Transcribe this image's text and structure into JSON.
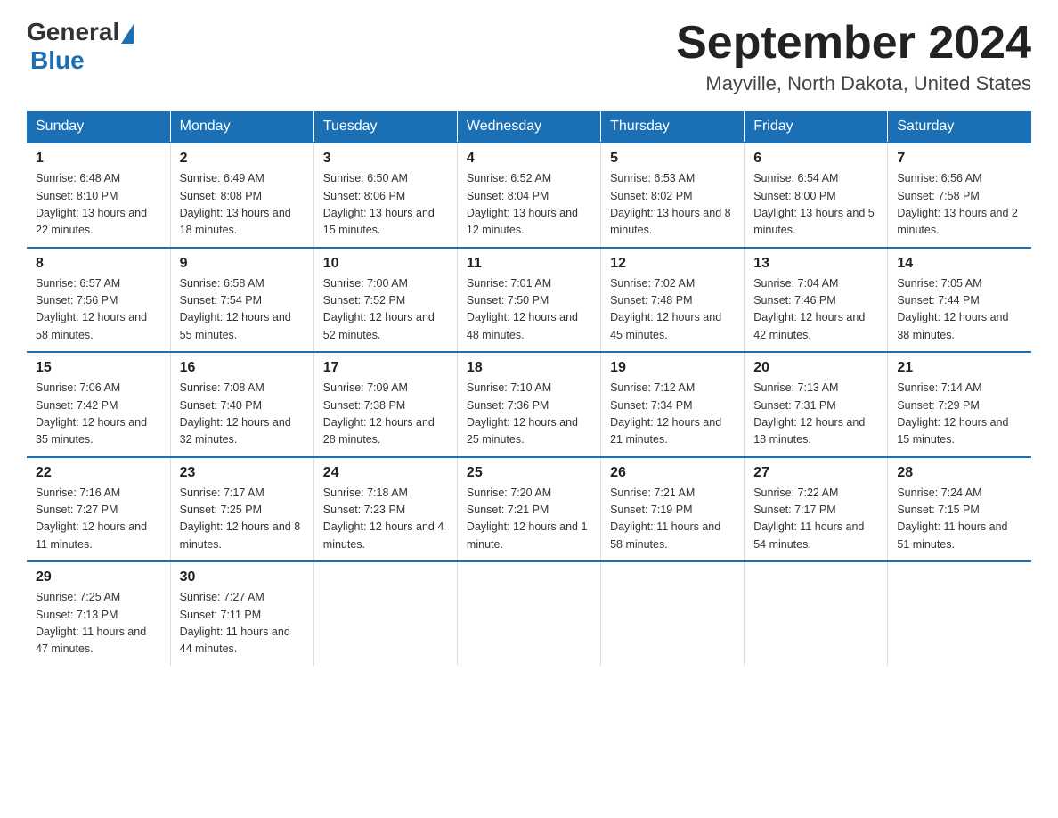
{
  "logo": {
    "general": "General",
    "blue": "Blue"
  },
  "title": "September 2024",
  "location": "Mayville, North Dakota, United States",
  "days_of_week": [
    "Sunday",
    "Monday",
    "Tuesday",
    "Wednesday",
    "Thursday",
    "Friday",
    "Saturday"
  ],
  "weeks": [
    [
      {
        "day": "1",
        "sunrise": "6:48 AM",
        "sunset": "8:10 PM",
        "daylight": "13 hours and 22 minutes."
      },
      {
        "day": "2",
        "sunrise": "6:49 AM",
        "sunset": "8:08 PM",
        "daylight": "13 hours and 18 minutes."
      },
      {
        "day": "3",
        "sunrise": "6:50 AM",
        "sunset": "8:06 PM",
        "daylight": "13 hours and 15 minutes."
      },
      {
        "day": "4",
        "sunrise": "6:52 AM",
        "sunset": "8:04 PM",
        "daylight": "13 hours and 12 minutes."
      },
      {
        "day": "5",
        "sunrise": "6:53 AM",
        "sunset": "8:02 PM",
        "daylight": "13 hours and 8 minutes."
      },
      {
        "day": "6",
        "sunrise": "6:54 AM",
        "sunset": "8:00 PM",
        "daylight": "13 hours and 5 minutes."
      },
      {
        "day": "7",
        "sunrise": "6:56 AM",
        "sunset": "7:58 PM",
        "daylight": "13 hours and 2 minutes."
      }
    ],
    [
      {
        "day": "8",
        "sunrise": "6:57 AM",
        "sunset": "7:56 PM",
        "daylight": "12 hours and 58 minutes."
      },
      {
        "day": "9",
        "sunrise": "6:58 AM",
        "sunset": "7:54 PM",
        "daylight": "12 hours and 55 minutes."
      },
      {
        "day": "10",
        "sunrise": "7:00 AM",
        "sunset": "7:52 PM",
        "daylight": "12 hours and 52 minutes."
      },
      {
        "day": "11",
        "sunrise": "7:01 AM",
        "sunset": "7:50 PM",
        "daylight": "12 hours and 48 minutes."
      },
      {
        "day": "12",
        "sunrise": "7:02 AM",
        "sunset": "7:48 PM",
        "daylight": "12 hours and 45 minutes."
      },
      {
        "day": "13",
        "sunrise": "7:04 AM",
        "sunset": "7:46 PM",
        "daylight": "12 hours and 42 minutes."
      },
      {
        "day": "14",
        "sunrise": "7:05 AM",
        "sunset": "7:44 PM",
        "daylight": "12 hours and 38 minutes."
      }
    ],
    [
      {
        "day": "15",
        "sunrise": "7:06 AM",
        "sunset": "7:42 PM",
        "daylight": "12 hours and 35 minutes."
      },
      {
        "day": "16",
        "sunrise": "7:08 AM",
        "sunset": "7:40 PM",
        "daylight": "12 hours and 32 minutes."
      },
      {
        "day": "17",
        "sunrise": "7:09 AM",
        "sunset": "7:38 PM",
        "daylight": "12 hours and 28 minutes."
      },
      {
        "day": "18",
        "sunrise": "7:10 AM",
        "sunset": "7:36 PM",
        "daylight": "12 hours and 25 minutes."
      },
      {
        "day": "19",
        "sunrise": "7:12 AM",
        "sunset": "7:34 PM",
        "daylight": "12 hours and 21 minutes."
      },
      {
        "day": "20",
        "sunrise": "7:13 AM",
        "sunset": "7:31 PM",
        "daylight": "12 hours and 18 minutes."
      },
      {
        "day": "21",
        "sunrise": "7:14 AM",
        "sunset": "7:29 PM",
        "daylight": "12 hours and 15 minutes."
      }
    ],
    [
      {
        "day": "22",
        "sunrise": "7:16 AM",
        "sunset": "7:27 PM",
        "daylight": "12 hours and 11 minutes."
      },
      {
        "day": "23",
        "sunrise": "7:17 AM",
        "sunset": "7:25 PM",
        "daylight": "12 hours and 8 minutes."
      },
      {
        "day": "24",
        "sunrise": "7:18 AM",
        "sunset": "7:23 PM",
        "daylight": "12 hours and 4 minutes."
      },
      {
        "day": "25",
        "sunrise": "7:20 AM",
        "sunset": "7:21 PM",
        "daylight": "12 hours and 1 minute."
      },
      {
        "day": "26",
        "sunrise": "7:21 AM",
        "sunset": "7:19 PM",
        "daylight": "11 hours and 58 minutes."
      },
      {
        "day": "27",
        "sunrise": "7:22 AM",
        "sunset": "7:17 PM",
        "daylight": "11 hours and 54 minutes."
      },
      {
        "day": "28",
        "sunrise": "7:24 AM",
        "sunset": "7:15 PM",
        "daylight": "11 hours and 51 minutes."
      }
    ],
    [
      {
        "day": "29",
        "sunrise": "7:25 AM",
        "sunset": "7:13 PM",
        "daylight": "11 hours and 47 minutes."
      },
      {
        "day": "30",
        "sunrise": "7:27 AM",
        "sunset": "7:11 PM",
        "daylight": "11 hours and 44 minutes."
      },
      {
        "day": "",
        "sunrise": "",
        "sunset": "",
        "daylight": ""
      },
      {
        "day": "",
        "sunrise": "",
        "sunset": "",
        "daylight": ""
      },
      {
        "day": "",
        "sunrise": "",
        "sunset": "",
        "daylight": ""
      },
      {
        "day": "",
        "sunrise": "",
        "sunset": "",
        "daylight": ""
      },
      {
        "day": "",
        "sunrise": "",
        "sunset": "",
        "daylight": ""
      }
    ]
  ]
}
